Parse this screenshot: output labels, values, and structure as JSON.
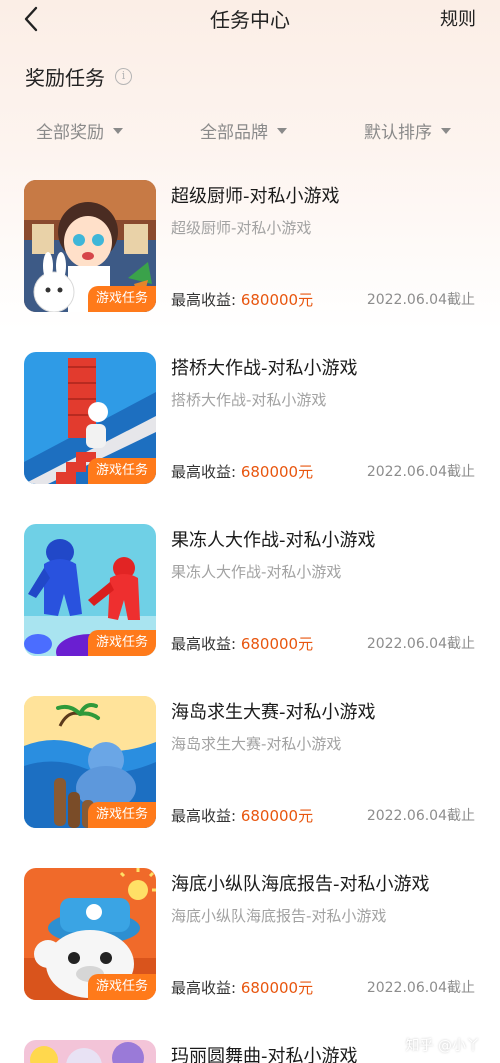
{
  "header": {
    "title": "任务中心",
    "rules_label": "规则"
  },
  "section": {
    "title": "奖励任务",
    "info_glyph": "i"
  },
  "filters": [
    "全部奖励",
    "全部品牌",
    "默认排序"
  ],
  "income_label": "最高收益:",
  "tasks": [
    {
      "title": "超级厨师-对私小游戏",
      "subtitle": "超级厨师-对私小游戏",
      "badge": "游戏任务",
      "amount": "680000元",
      "deadline": "2022.06.04截止"
    },
    {
      "title": "搭桥大作战-对私小游戏",
      "subtitle": "搭桥大作战-对私小游戏",
      "badge": "游戏任务",
      "amount": "680000元",
      "deadline": "2022.06.04截止"
    },
    {
      "title": "果冻人大作战-对私小游戏",
      "subtitle": "果冻人大作战-对私小游戏",
      "badge": "游戏任务",
      "amount": "680000元",
      "deadline": "2022.06.04截止"
    },
    {
      "title": "海岛求生大赛-对私小游戏",
      "subtitle": "海岛求生大赛-对私小游戏",
      "badge": "游戏任务",
      "amount": "680000元",
      "deadline": "2022.06.04截止"
    },
    {
      "title": "海底小纵队海底报告-对私小游戏",
      "subtitle": "海底小纵队海底报告-对私小游戏",
      "badge": "游戏任务",
      "amount": "680000元",
      "deadline": "2022.06.04截止"
    },
    {
      "title": "玛丽圆舞曲-对私小游戏",
      "subtitle": "",
      "badge": "",
      "amount": "",
      "deadline": ""
    }
  ],
  "watermark": "知乎 @小丫",
  "colors": {
    "accent": "#e8560f",
    "badge": "#ff7a1a"
  }
}
